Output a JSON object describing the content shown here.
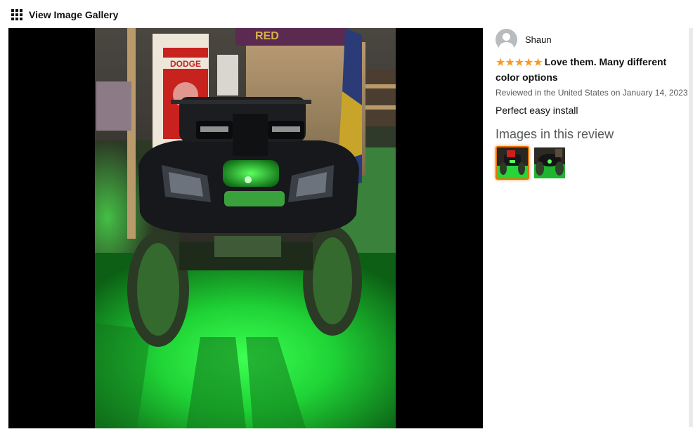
{
  "gallery": {
    "label": "View Image Gallery",
    "icon": "grid-icon"
  },
  "review": {
    "reviewer_name": "Shaun",
    "rating": 5,
    "stars_text": "★★★★★",
    "title": "Love them. Many different color options",
    "meta": "Reviewed in the United States on January 14, 2023",
    "body": "Perfect easy install",
    "images_heading": "Images in this review",
    "thumbnails": [
      {
        "name": "review-image-1",
        "selected": true
      },
      {
        "name": "review-image-2",
        "selected": false
      }
    ]
  },
  "colors": {
    "star": "#f79b2a",
    "selected_border": "#e77600",
    "underglow": "#2cff3a"
  },
  "photo_sign_text": "DODGE"
}
